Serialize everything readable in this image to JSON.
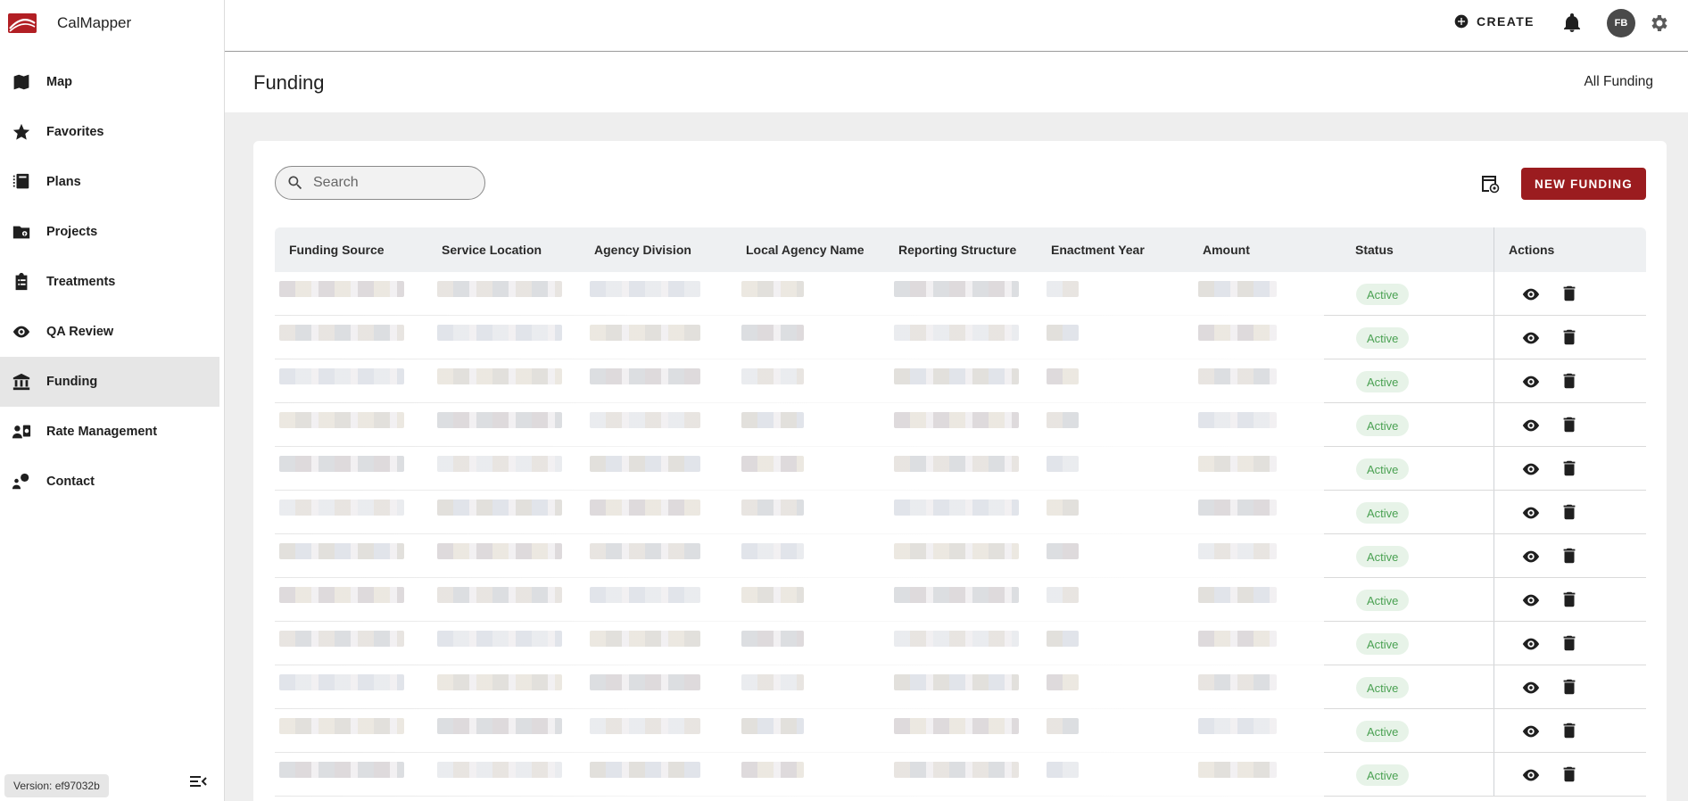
{
  "app": {
    "name": "CalMapper"
  },
  "sidebar": {
    "items": [
      {
        "label": "Map",
        "icon": "map-icon"
      },
      {
        "label": "Favorites",
        "icon": "star-icon"
      },
      {
        "label": "Plans",
        "icon": "plans-icon"
      },
      {
        "label": "Projects",
        "icon": "folder-icon"
      },
      {
        "label": "Treatments",
        "icon": "clipboard-icon"
      },
      {
        "label": "QA Review",
        "icon": "eye-icon"
      },
      {
        "label": "Funding",
        "icon": "bank-icon",
        "active": true
      },
      {
        "label": "Rate Management",
        "icon": "rate-icon"
      },
      {
        "label": "Contact",
        "icon": "contact-icon"
      }
    ],
    "version": "Version: ef97032b"
  },
  "topbar": {
    "create_label": "CREATE",
    "avatar_initials": "FB"
  },
  "page": {
    "title": "Funding",
    "crumb": "All Funding"
  },
  "toolbar": {
    "search_placeholder": "Search",
    "new_button_label": "NEW FUNDING"
  },
  "table": {
    "columns": [
      "Funding Source",
      "Service Location",
      "Agency Division",
      "Local Agency Name",
      "Reporting Structure",
      "Enactment Year",
      "Amount",
      "Status",
      "Actions"
    ],
    "rows": [
      {
        "status": "Active"
      },
      {
        "status": "Active"
      },
      {
        "status": "Active"
      },
      {
        "status": "Active"
      },
      {
        "status": "Active"
      },
      {
        "status": "Active"
      },
      {
        "status": "Active"
      },
      {
        "status": "Active"
      },
      {
        "status": "Active"
      },
      {
        "status": "Active"
      },
      {
        "status": "Active"
      },
      {
        "status": "Active"
      }
    ]
  },
  "colors": {
    "brand": "#9b1c1f",
    "status_active_bg": "#e7f3e8",
    "status_active_text": "#4aa152"
  }
}
